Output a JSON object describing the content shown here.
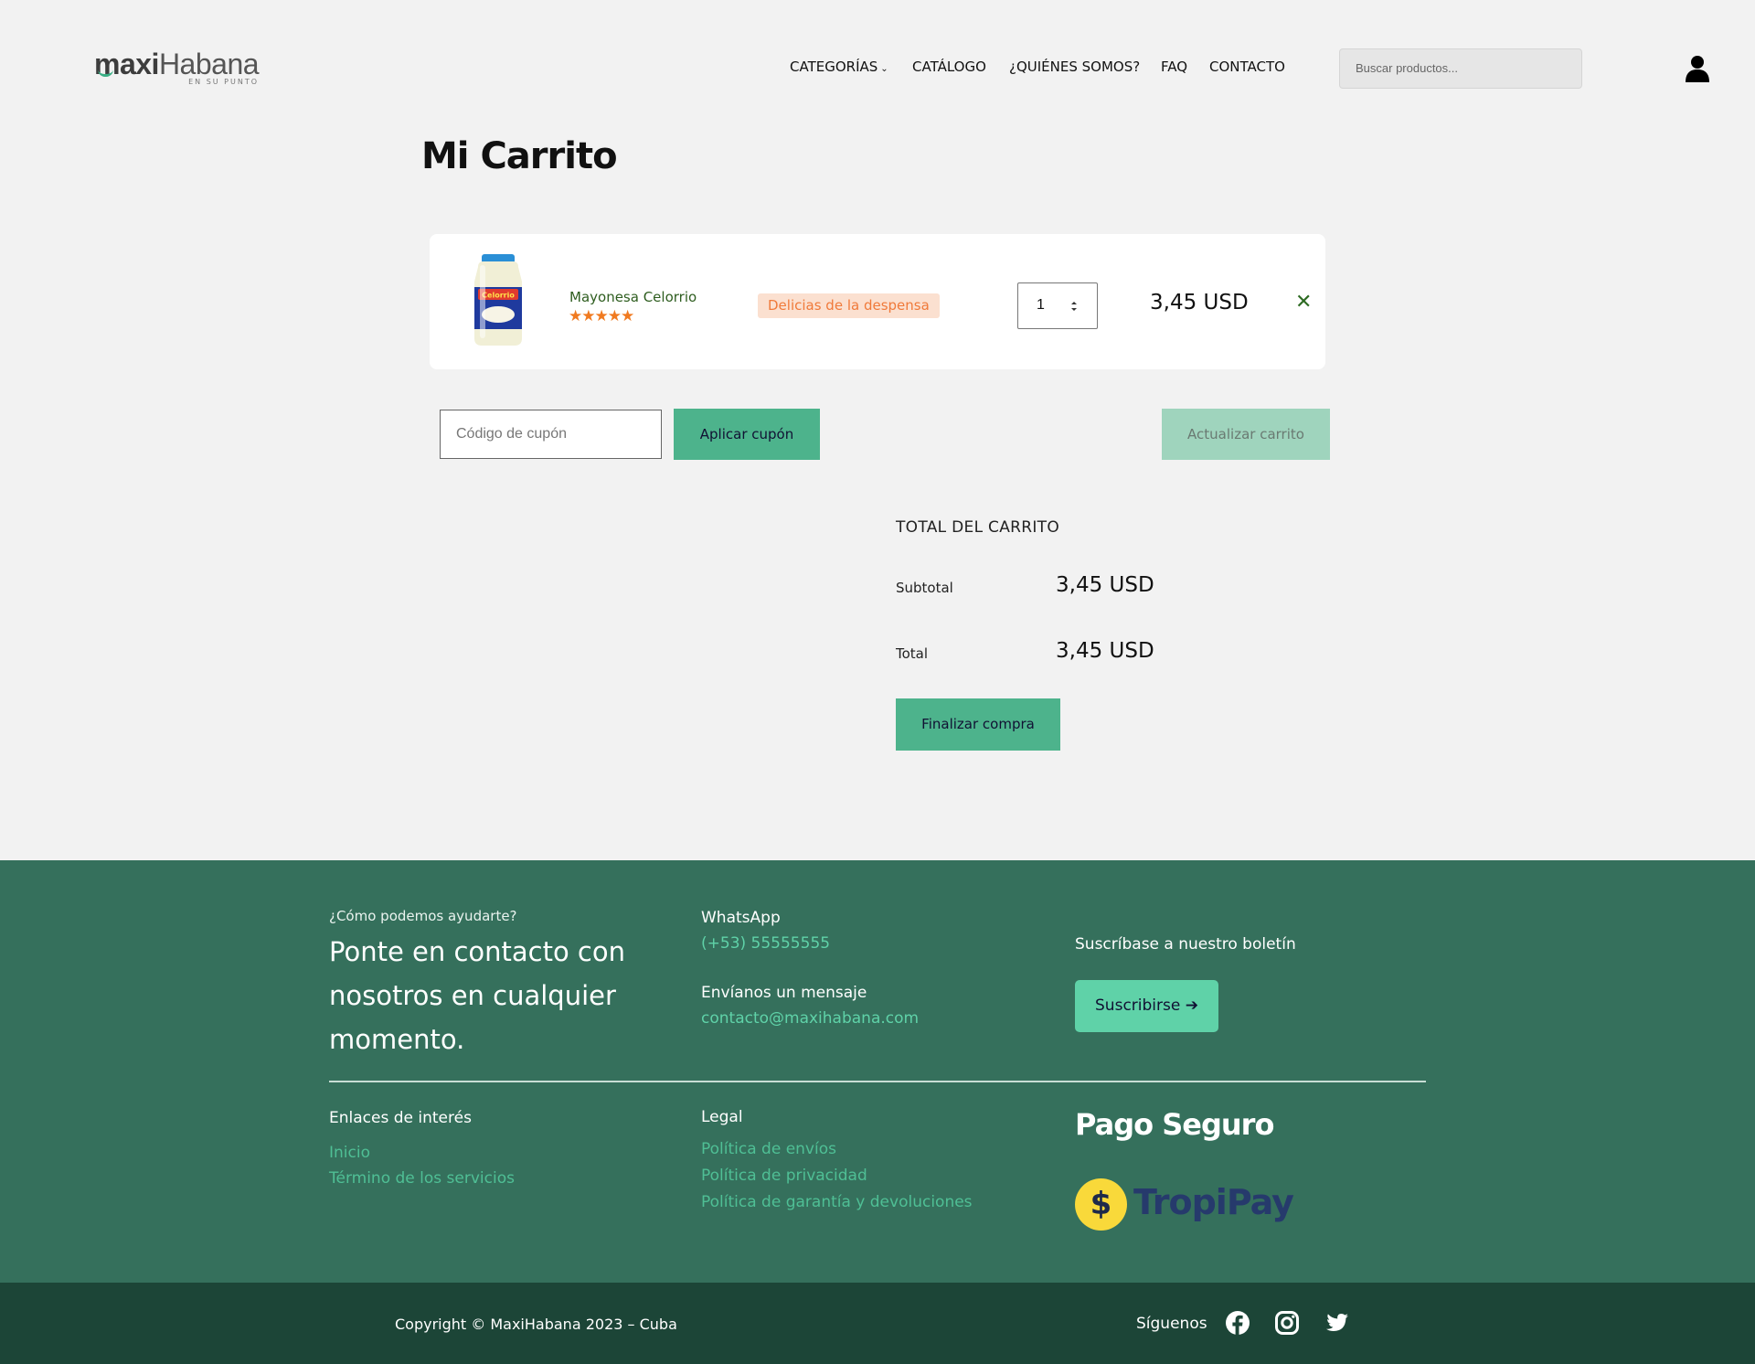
{
  "header": {
    "logo": {
      "bold": "maxi",
      "light": "Habana",
      "tagline": "EN SU PUNTO"
    },
    "nav": [
      {
        "label": "CATEGORÍAS"
      },
      {
        "label": "CATÁLOGO"
      },
      {
        "label": "¿QUIÉNES SOMOS?"
      },
      {
        "label": "FAQ"
      },
      {
        "label": "CONTACTO"
      }
    ],
    "search_placeholder": "Buscar productos..."
  },
  "page_title": "Mi Carrito",
  "cart": {
    "items": [
      {
        "name": "Mayonesa Celorrio",
        "rating": 5,
        "stars": "★★★★★",
        "category": "Delicias de la despensa",
        "quantity": "1",
        "price": "3,45 USD",
        "image_label": "Celorrio"
      }
    ],
    "coupon_placeholder": "Código de cupón",
    "apply_coupon": "Aplicar cupón",
    "update_cart": "Actualizar carrito"
  },
  "totals": {
    "title": "TOTAL DEL CARRITO",
    "subtotal_label": "Subtotal",
    "subtotal_value": "3,45 USD",
    "total_label": "Total",
    "total_value": "3,45 USD",
    "checkout": "Finalizar compra"
  },
  "footer": {
    "help": "¿Cómo podemos ayudarte?",
    "headline": "Ponte en contacto con nosotros en cualquier momento.",
    "whatsapp_label": "WhatsApp",
    "whatsapp_value": "(+53) 55555555",
    "message_label": "Envíanos un mensaje",
    "message_value": "contacto@maxihabana.com",
    "newsletter": "Suscríbase a nuestro boletín",
    "subscribe": "Suscribirse",
    "links_title": "Enlaces de interés",
    "links": [
      "Inicio",
      "Término de los servicios"
    ],
    "legal_title": "Legal",
    "legal": [
      "Política de envíos",
      "Política de privacidad",
      "Política de garantía y devoluciones"
    ],
    "secure_title": "Pago Seguro",
    "payment_brand": "TropiPay",
    "payment_coin": "$",
    "copyright": "Copyright © MaxiHabana 2023 – Cuba",
    "follow": "Síguenos",
    "social": [
      "facebook-icon",
      "instagram-icon",
      "twitter-icon"
    ]
  },
  "colors": {
    "accent": "#4db38c",
    "footer_bg": "#35705c",
    "bottom_bar": "#1c4537",
    "badge_bg": "#fbe0d0",
    "badge_text": "#f07a3a",
    "star": "#f07a20"
  }
}
